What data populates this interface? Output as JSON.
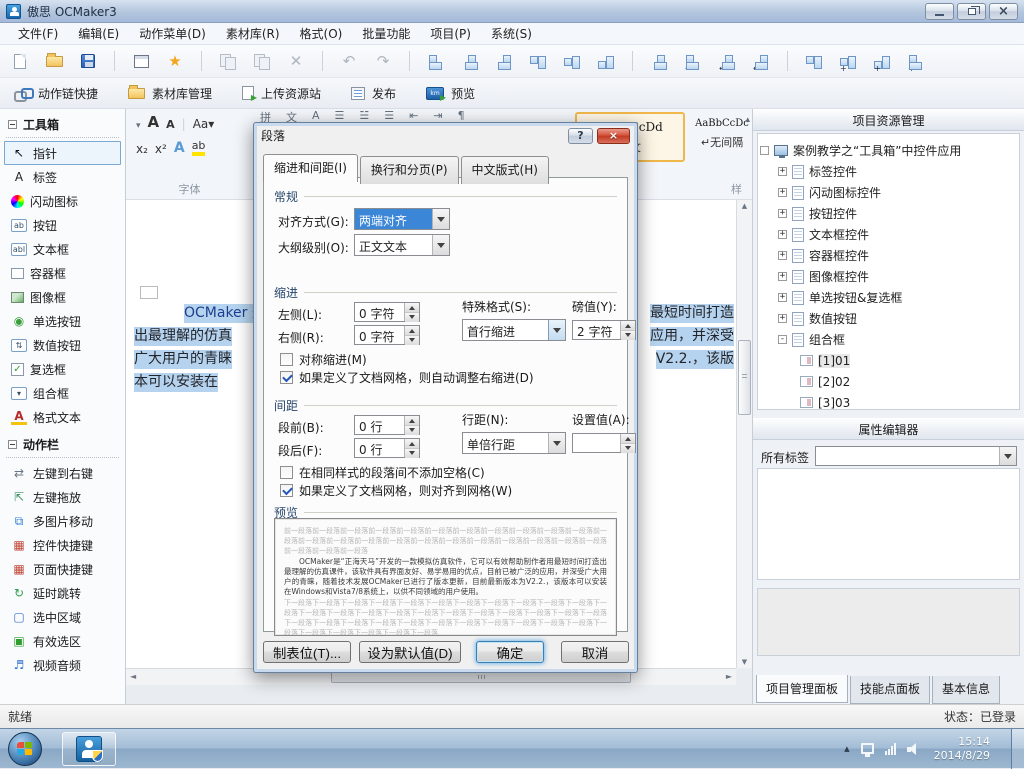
{
  "window": {
    "title": "傲思 OCMaker3"
  },
  "menu": {
    "items": [
      "文件(F)",
      "编辑(E)",
      "动作菜单(D)",
      "素材库(R)",
      "格式(O)",
      "批量功能",
      "项目(P)",
      "系统(S)"
    ]
  },
  "toolbar_icons": [
    "new-document",
    "open-folder",
    "save",
    "form-view",
    "favorites-star",
    "copy",
    "paste",
    "delete",
    "undo",
    "redo",
    "align-left",
    "align-center-horizontal",
    "align-right",
    "align-top",
    "align-middle",
    "align-bottom",
    "make-same-size",
    "equal-horizontal-spacing",
    "increase-horizontal-spacing",
    "decrease-horizontal-spacing",
    "distribute-vertical",
    "equal-vertical-spacing",
    "increase-vertical-spacing",
    "decrease-vertical-spacing"
  ],
  "quickbar": {
    "items": [
      "动作链快捷",
      "素材库管理",
      "上传资源站",
      "发布",
      "预览"
    ]
  },
  "icons": {
    "window-close": "×",
    "dialog-help": "?",
    "dialog-close": "×",
    "scroll-left": "◄",
    "scroll-right": "►",
    "scroll-up": "▲",
    "scroll-down": "▼",
    "tray-expand": "▴",
    "gallery-up": "▴",
    "delete": "✕",
    "undo": "↶",
    "redo": "↷",
    "star": "★",
    "h-arrows": "↔",
    "plus": "+"
  },
  "toolbox": {
    "title": "工具箱",
    "items": [
      {
        "icon": "↖",
        "label": "指针",
        "cls": "sel",
        "color": "#111111"
      },
      {
        "icon": "A",
        "label": "标签",
        "color": "#222222"
      },
      {
        "icon": "●",
        "label": "闪动图标"
      },
      {
        "icon": "ab",
        "label": "按钮",
        "color": "#334f6b"
      },
      {
        "icon": "abl",
        "label": "文本框",
        "color": "#334f6b"
      },
      {
        "icon": "▢",
        "label": "容器框"
      },
      {
        "icon": "▨",
        "label": "图像框"
      },
      {
        "icon": "◉",
        "label": "单选按钮",
        "color": "#3a9e3a"
      },
      {
        "icon": "⇅",
        "label": "数值按钮",
        "color": "#334f6b"
      },
      {
        "icon": "✓",
        "label": "复选框",
        "color": "#2f9e2f"
      },
      {
        "icon": "▾",
        "label": "组合框",
        "color": "#334f6b"
      },
      {
        "icon": "A",
        "label": "格式文本",
        "cls": "fmt",
        "color": "#b52b2b"
      }
    ]
  },
  "actionbar": {
    "title": "动作栏",
    "items": [
      {
        "icon": "⇄",
        "label": "左键到右键",
        "color": "#6b7684"
      },
      {
        "icon": "⇱",
        "label": "左键拖放",
        "color": "#3a8f5f"
      },
      {
        "icon": "⧉",
        "label": "多图片移动",
        "color": "#2b7fd0"
      },
      {
        "icon": "▦",
        "label": "控件快捷键",
        "color": "#c04a3a"
      },
      {
        "icon": "▦",
        "label": "页面快捷键",
        "color": "#c04a3a"
      },
      {
        "icon": "↻",
        "label": "延时跳转",
        "color": "#2e9e4f"
      },
      {
        "icon": "▢",
        "label": "选中区域",
        "color": "#3a6fd0"
      },
      {
        "icon": "▣",
        "label": "有效选区",
        "color": "#2f9e2f"
      },
      {
        "icon": "♬",
        "label": "视频音频",
        "color": "#2b6fd0"
      }
    ]
  },
  "ribbon": {
    "font_group_label": "字体",
    "styles_group_label": "样",
    "mini_glyphs": [
      "拼",
      "文",
      "A",
      "☰",
      "☱",
      "☰",
      "⇤",
      "⇥",
      "¶"
    ],
    "font_controls": {
      "grow": "A",
      "shrink": "A",
      "case": "Aa▾",
      "sub": "x₂",
      "sup": "x²",
      "effects": "A",
      "highlight": "ab"
    },
    "style_cards": [
      {
        "sample": "AaBbCcDd",
        "name": "正文"
      },
      {
        "sample": "AaBbCcDc",
        "name": "↵无间隔"
      }
    ]
  },
  "document": {
    "left_lines": [
      "OCMaker 是",
      "出最理解的仿真",
      "广大用户的青睐",
      "本可以安装在 "
    ],
    "right_lines": [
      "最短时间打造",
      "应用，并深受",
      "V2.2.，该版"
    ]
  },
  "dialog": {
    "title": "段落",
    "help_icon": "?",
    "close_icon": "×",
    "tabs": [
      "缩进和间距(I)",
      "换行和分页(P)",
      "中文版式(H)"
    ],
    "group_general": "常规",
    "group_indent": "缩进",
    "group_spacing": "间距",
    "group_preview": "预览",
    "alignment_label": "对齐方式(G):",
    "alignment_value": "两端对齐",
    "outline_label": "大纲级别(O):",
    "outline_value": "正文文本",
    "indent_left_label": "左侧(L):",
    "indent_left_value": "0 字符",
    "indent_right_label": "右侧(R):",
    "indent_right_value": "0 字符",
    "special_label": "特殊格式(S):",
    "special_value": "首行缩进",
    "by_label": "磅值(Y):",
    "by_value": "2 字符",
    "before_label": "段前(B):",
    "before_value": "0 行",
    "after_label": "段后(F):",
    "after_value": "0 行",
    "line_spacing_label": "行距(N):",
    "line_spacing_value": "单倍行距",
    "at_label": "设置值(A):",
    "at_value": "",
    "cb_mirror": {
      "label": "对称缩进(M)",
      "checked": false
    },
    "cb_auto_right": {
      "label": "如果定义了文档网格，则自动调整右缩进(D)",
      "checked": true
    },
    "cb_no_space": {
      "label": "在相同样式的段落间不添加空格(C)",
      "checked": false
    },
    "cb_grid": {
      "label": "如果定义了文档网格，则对齐到网格(W)",
      "checked": true
    },
    "preview_before": "前一段落前一段落前一段落前一段落前一段落前一段落前一段落前一段落前一段落前一段落前一段落前一段落前一段落前一段落前一段落前一段落前一段落前一段落前一段落前一段落前一段落前一段落前一段落前一段落前一段落前一段落",
    "preview_sample": "OCMaker是“正海天马”开发的一款模拟仿真软件，它可以有效帮助制作者用最短时间打造出最理解的仿真课件，该软件具有界面友好、易学易用的优点，目前已被广泛的应用，并深受广大用户的青睐，随着技术发展OCMaker已进行了版本更新，目前最新版本为V2.2.，该版本可以安装在Windows和Vista7/8系统上，以供不同领域的用户使用。",
    "preview_after": "下一段落下一段落下一段落下一段落下一段落下一段落下一段落下一段落下一段落下一段落下一段落下一段落下一段落下一段落下一段落下一段落下一段落下一段落下一段落下一段落下一段落下一段落下一段落下一段落下一段落下一段落下一段落下一段落下一段落下一段落下一段落下一段落下一段落下一段落下一段落下一段落下一段落下一段落下一段落下一段落",
    "buttons": [
      "制表位(T)...",
      "设为默认值(D)",
      "确定",
      "取消"
    ]
  },
  "resource_panel": {
    "title": "项目资源管理",
    "root_label": "案例教学之“工具箱”中控件应用",
    "nodes": [
      {
        "exp": "+",
        "label": "标签控件"
      },
      {
        "exp": "+",
        "label": "闪动图标控件"
      },
      {
        "exp": "+",
        "label": "按钮控件"
      },
      {
        "exp": "+",
        "label": "文本框控件"
      },
      {
        "exp": "+",
        "label": "容器框控件"
      },
      {
        "exp": "+",
        "label": "图像框控件"
      },
      {
        "exp": "+",
        "label": "单选按钮&复选框"
      },
      {
        "exp": "+",
        "label": "数值按钮"
      },
      {
        "exp": "-",
        "label": "组合框"
      }
    ],
    "combo_children": [
      {
        "label": "[1]01",
        "cls": "hl"
      },
      {
        "label": "[2]02"
      },
      {
        "label": "[3]03"
      }
    ]
  },
  "property_panel": {
    "title": "属性编辑器",
    "all_tags_label": "所有标签",
    "tabs": [
      "项目管理面板",
      "技能点面板",
      "基本信息"
    ]
  },
  "statusbar": {
    "left": "就绪",
    "right": "状态：已登录"
  },
  "taskbar": {
    "time": "15:14",
    "date": "2014/8/29",
    "tray_icons": [
      "expand-tray",
      "network-status",
      "signal-strength",
      "volume"
    ]
  }
}
